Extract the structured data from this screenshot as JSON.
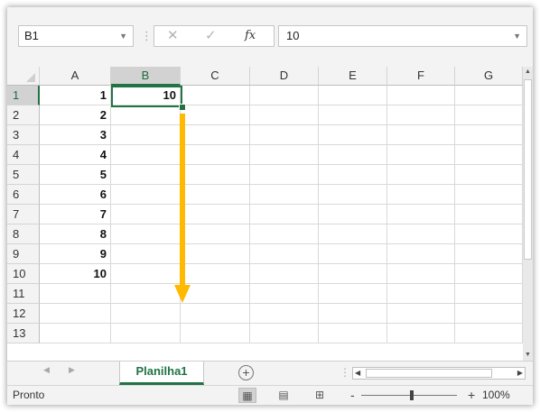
{
  "formula_bar": {
    "name_box": "B1",
    "cancel_icon": "✕",
    "enter_icon": "✓",
    "fx_label": "fx",
    "formula": "10",
    "name_box_dropdown_icon": "chevron-down-icon",
    "formula_expand_icon": "chevron-down-icon"
  },
  "grid": {
    "columns": [
      "A",
      "B",
      "C",
      "D",
      "E",
      "F",
      "G"
    ],
    "selected_column": "B",
    "rows": [
      "1",
      "2",
      "3",
      "4",
      "5",
      "6",
      "7",
      "8",
      "9",
      "10",
      "11",
      "12",
      "13"
    ],
    "selected_row": "1",
    "column_a_values": [
      "1",
      "2",
      "3",
      "4",
      "5",
      "6",
      "7",
      "8",
      "9",
      "10"
    ],
    "b1_value": "10",
    "active_cell": "B1",
    "annotation": {
      "type": "fill-down-arrow",
      "color": "#FFB900",
      "from": "B1",
      "to": "B10"
    }
  },
  "sheet_tabs": {
    "prev_icon": "◀",
    "next_icon": "▶",
    "active_sheet": "Planilha1",
    "add_icon": "+"
  },
  "status_bar": {
    "ready": "Pronto",
    "zoom_minus": "-",
    "zoom_plus": "+",
    "zoom": "100%"
  },
  "colors": {
    "accent": "#217346",
    "header_bg": "#F3F3F3",
    "arrow": "#FFB900"
  }
}
